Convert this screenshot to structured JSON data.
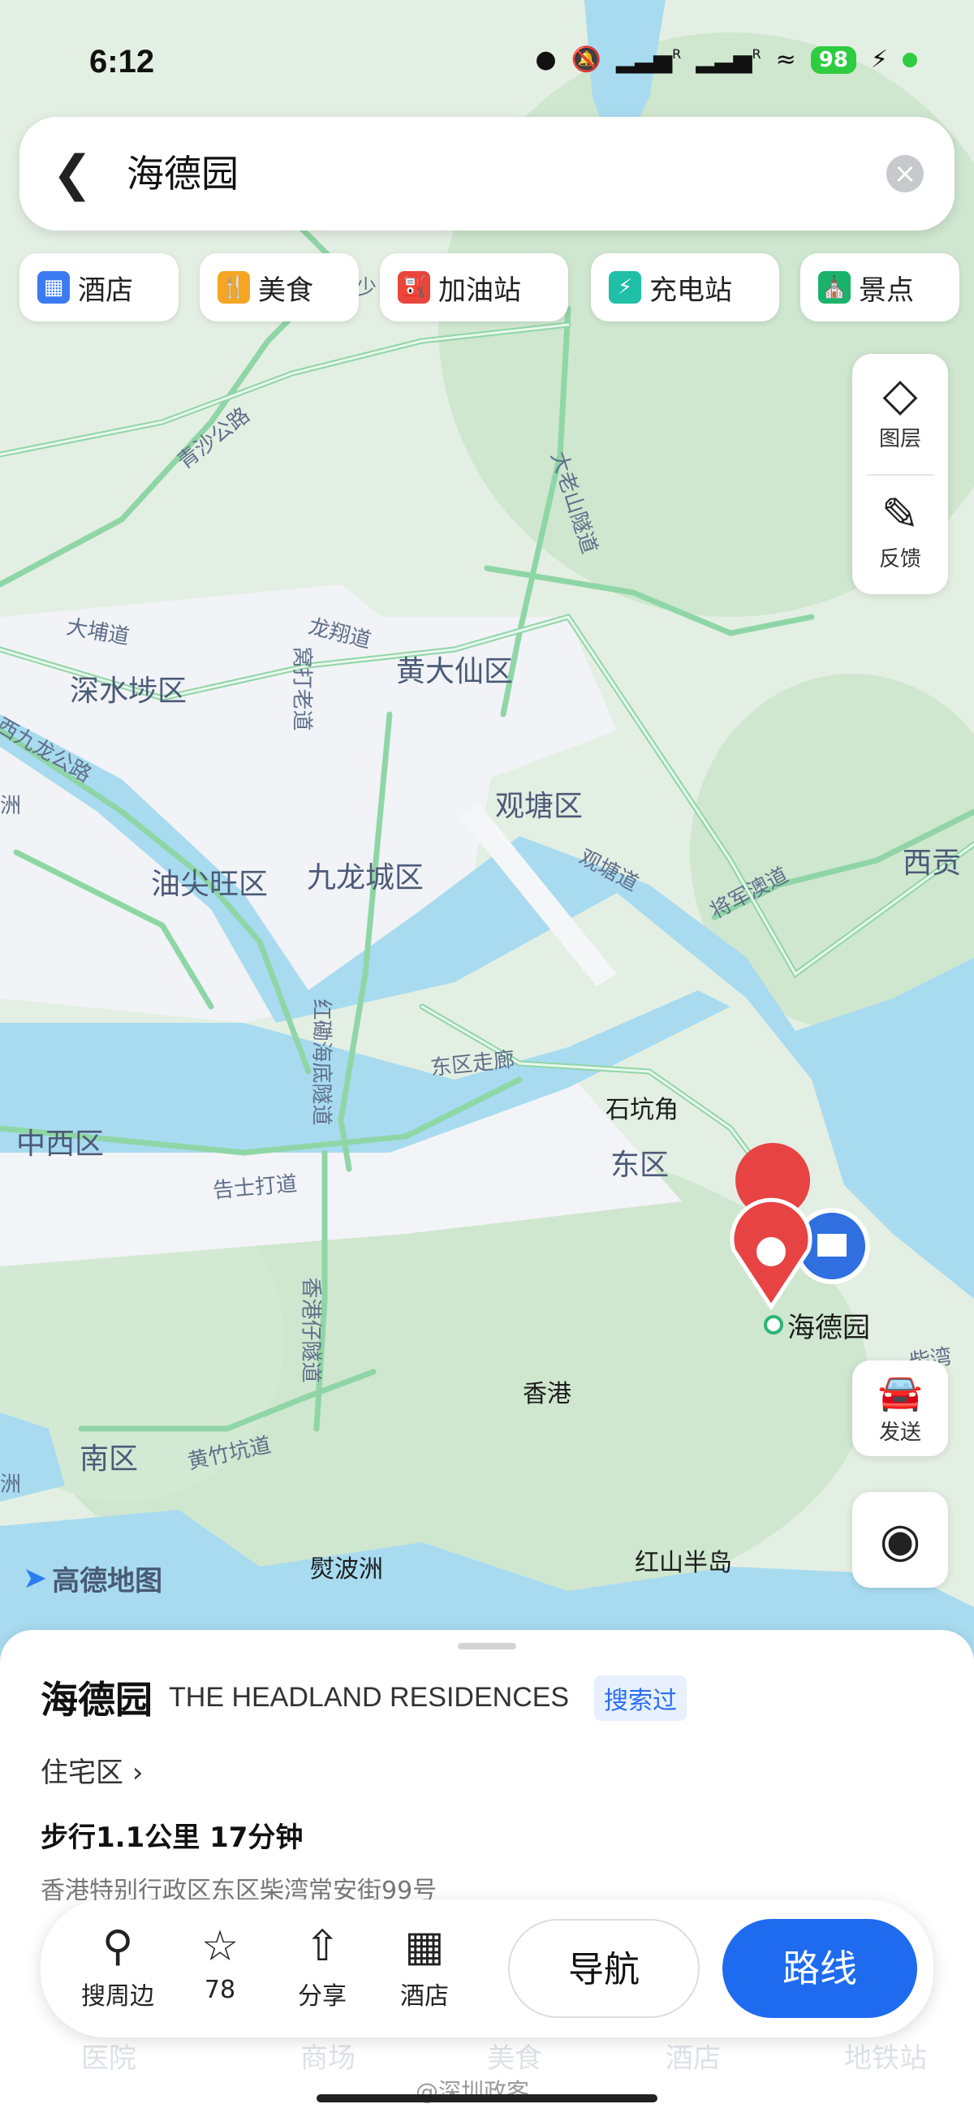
{
  "status": {
    "time": "6:12",
    "signal_badge_1": "R",
    "signal_badge_2": "R",
    "battery": "98"
  },
  "search": {
    "query": "海德园",
    "back_icon": "chevron-left-icon",
    "clear_icon": "close-circle-icon"
  },
  "chips": [
    {
      "label": "酒店",
      "icon": "hotel-icon",
      "color": "#3a7bf0"
    },
    {
      "label": "美食",
      "icon": "fork-knife-icon",
      "color": "#f5a623"
    },
    {
      "label": "加油站",
      "icon": "gas-station-icon",
      "color": "#e8453c"
    },
    {
      "label": "充电站",
      "icon": "charging-icon",
      "color": "#1fbfa8"
    },
    {
      "label": "景点",
      "icon": "pavilion-icon",
      "color": "#1ab26b"
    }
  ],
  "side_tools": {
    "layers_label": "图层",
    "feedback_label": "反馈",
    "send_label": "发送"
  },
  "map_labels": {
    "sham_shui_po": "深水埗区",
    "wong_tai_sin": "黄大仙区",
    "kwun_tong": "观塘区",
    "yau_tsim_mong": "油尖旺区",
    "kowloon_city": "九龙城区",
    "central_western": "中西区",
    "eastern": "东区",
    "southern": "南区",
    "sai_kung": "西贡",
    "hong_kong": "香港",
    "shek_kip_mei_island": "熨波洲",
    "red_hill": "红山半岛",
    "shek_hang_kok": "石坑角",
    "marker": "海德园",
    "qingsha": "青沙公路",
    "tai_lo_shan": "大老山隧道",
    "tai_kok_tsui": "大埔道",
    "lung_cheung": "龙翔道",
    "cheung_sha_wan": "窝打老道",
    "west_kowloon": "西九龙公路",
    "kwun_tong_road": "观塘道",
    "tseung_kwan_o": "将军澳道",
    "cross_harbour": "红磡海底隧道",
    "eastern_corridor": "东区走廊",
    "gloucester": "告士打道",
    "aberdeen_tunnel": "香港仔隧道",
    "wong_chuk_hang": "黄竹坑道",
    "chai_wan": "柴湾",
    "partial_left_1": "洲",
    "partial_left_2": "洲",
    "partial_sai_kung": "少"
  },
  "map_logo": "高德地图",
  "place": {
    "name": "海德园",
    "name_en": "THE HEADLAND RESIDENCES",
    "badge": "搜索过",
    "category": "住宅区",
    "walk": "步行1.1公里 17分钟",
    "address": "香港特别行政区东区柴湾常安街99号"
  },
  "actions": {
    "nearby": "搜周边",
    "favorite": "78",
    "share": "分享",
    "hotel": "酒店",
    "navigate": "导航",
    "route": "路线"
  },
  "bottom_ghost": [
    "医院",
    "商场",
    "美食",
    "酒店",
    "地铁站"
  ],
  "watermark": "@深圳政客"
}
